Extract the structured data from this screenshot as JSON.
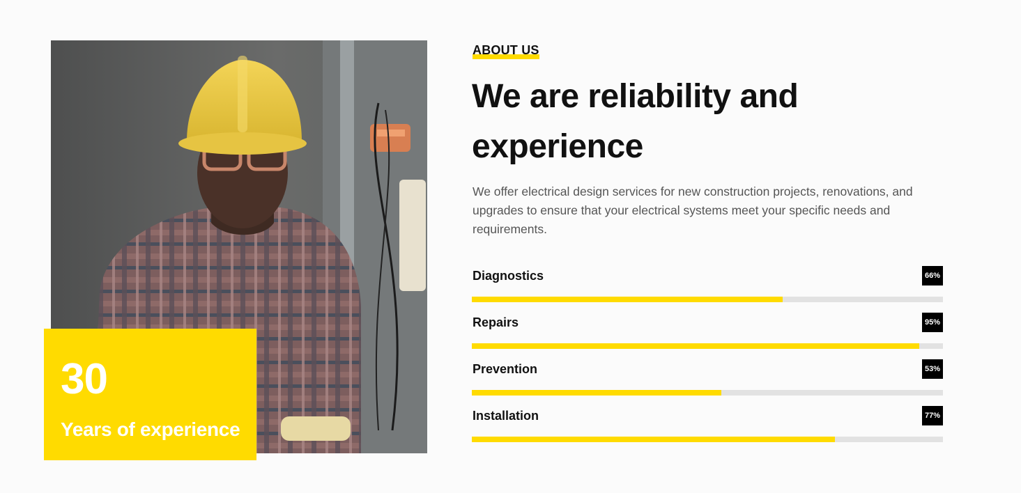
{
  "accent_color": "#ffdb00",
  "photo": {
    "subject": "worker-with-yellow-hard-hat"
  },
  "experience": {
    "number": "30",
    "label": "Years of experience"
  },
  "about": {
    "eyebrow": "ABOUT US",
    "headline_line1": "We are reliability and",
    "headline_line2": "experience",
    "description": "We offer electrical design services for new construction projects, renovations, and upgrades to ensure that your electrical systems meet your specific needs and requirements."
  },
  "skills": [
    {
      "name": "Diagnostics",
      "percent_label": "66%",
      "value": 66
    },
    {
      "name": "Repairs",
      "percent_label": "95%",
      "value": 95
    },
    {
      "name": "Prevention",
      "percent_label": "53%",
      "value": 53
    },
    {
      "name": "Installation",
      "percent_label": "77%",
      "value": 77
    }
  ]
}
